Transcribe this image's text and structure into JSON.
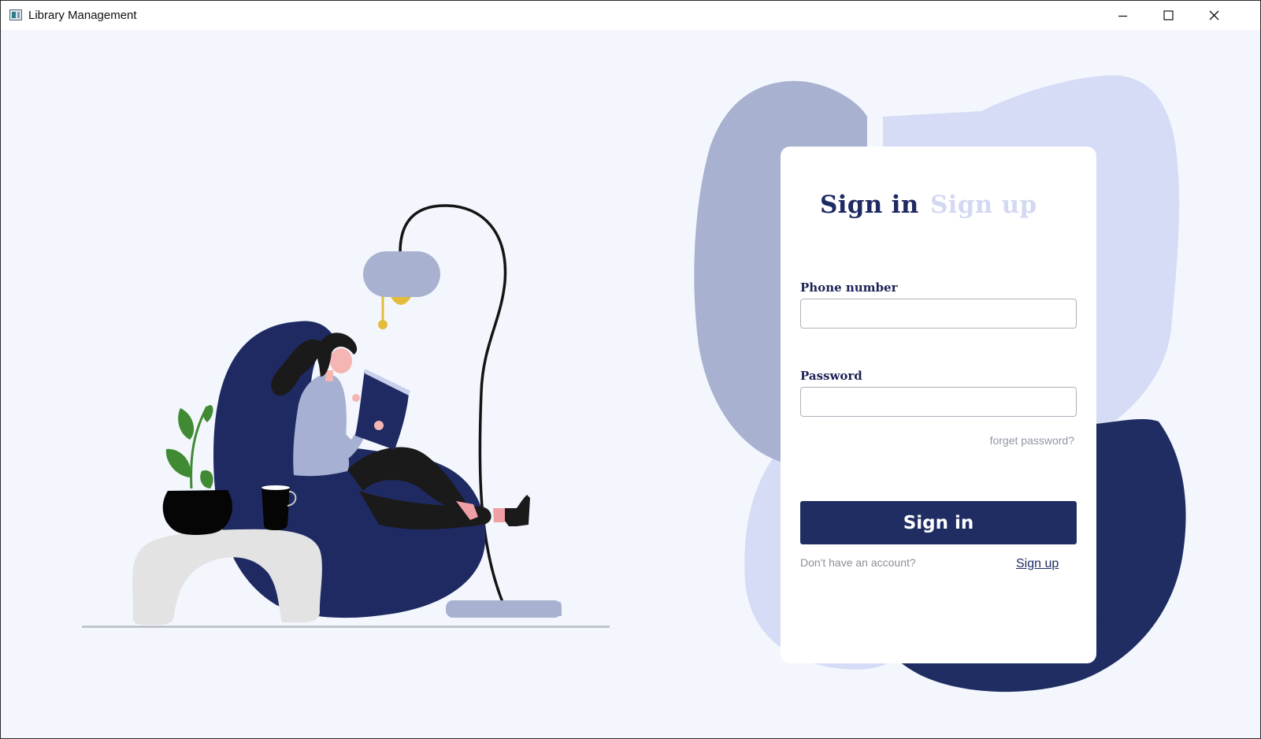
{
  "window": {
    "title": "Library Management",
    "controls": [
      "minimize",
      "maximize",
      "close"
    ]
  },
  "colors": {
    "background": "#f3f7fd",
    "primary": "#1f2d63",
    "blob_grey_blue": "#a8b2d0",
    "blob_light": "#d6dcf6",
    "blob_navy": "#1f2d63",
    "inactive_tab": "#d3d9f1"
  },
  "login": {
    "tabs": {
      "active": "Sign in",
      "inactive": "Sign up"
    },
    "phone_label": "Phone number",
    "phone_value": "",
    "password_label": "Password",
    "password_value": "",
    "forget_password": "forget password?",
    "submit_label": "Sign in",
    "no_account_text": "Don't have an account?",
    "signup_link": "Sign up"
  },
  "illustration": {
    "icons": [
      "floor-lamp-icon",
      "beanbag-chair-icon",
      "reading-woman-icon",
      "book-icon",
      "plant-pot-icon",
      "mug-icon",
      "side-table-icon"
    ]
  }
}
